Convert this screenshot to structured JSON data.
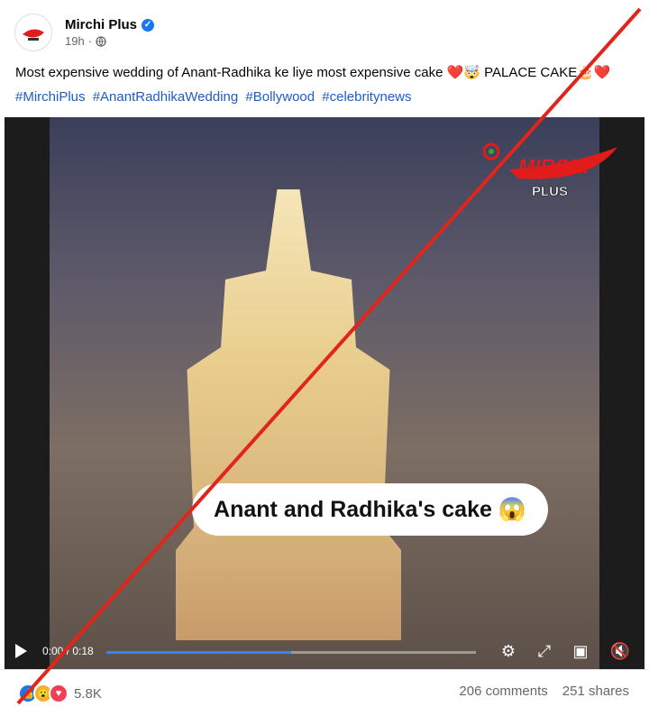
{
  "page": {
    "name": "Mirchi Plus",
    "time": "19h",
    "privacy_icon": "globe-icon"
  },
  "caption": "Most expensive wedding of Anant-Radhika ke liye most expensive cake ❤️🤯 PALACE CAKE🎂❤️",
  "hashtags": [
    "#MirchiPlus",
    "#AnantRadhikaWedding",
    "#Bollywood",
    "#celebritynews"
  ],
  "video": {
    "overlay_text": "Anant and Radhika's cake 😱",
    "watermark_brand": "MIRCHI",
    "watermark_sub": "PLUS",
    "current_time": "0:00",
    "duration": "0:18",
    "progress": 0.5
  },
  "engagement": {
    "reaction_count": "5.8K",
    "comments": "206 comments",
    "shares": "251 shares"
  },
  "colors": {
    "accent": "#1877f2",
    "hashtag": "#1f5cc4",
    "cross": "#e0251b"
  }
}
